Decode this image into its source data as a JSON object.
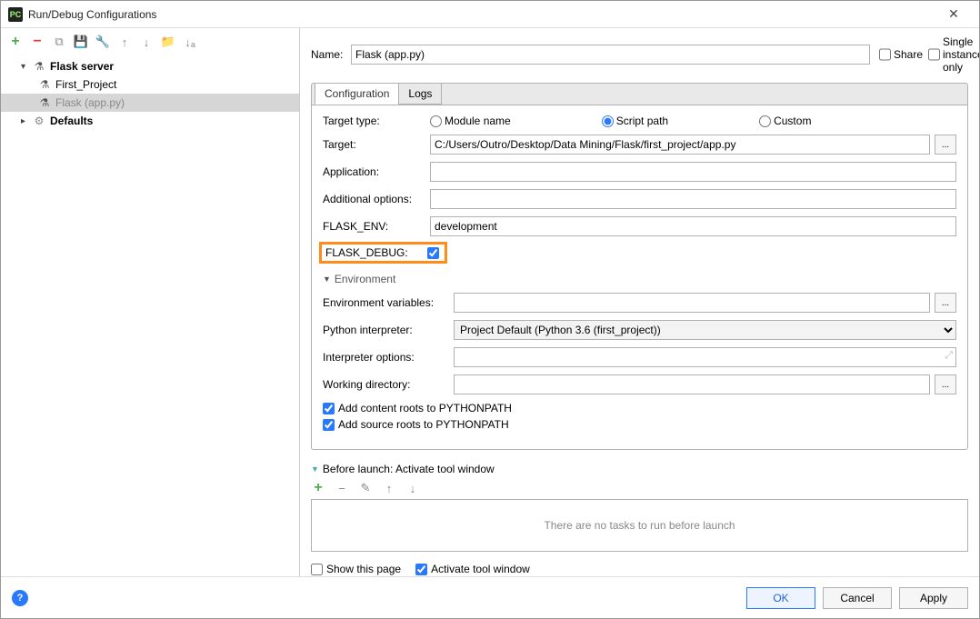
{
  "title": "Run/Debug Configurations",
  "toolbar": {
    "add": "+",
    "remove": "−"
  },
  "tree": {
    "group": "Flask server",
    "items": [
      "First_Project",
      "Flask (app.py)"
    ],
    "defaults": "Defaults"
  },
  "name": {
    "label": "Name:",
    "value": "Flask (app.py)"
  },
  "share": "Share",
  "single_instance": "Single instance only",
  "tabs": {
    "config": "Configuration",
    "logs": "Logs"
  },
  "form": {
    "target_type": "Target type:",
    "module_name": "Module name",
    "script_path": "Script path",
    "custom": "Custom",
    "target": "Target:",
    "target_value": "C:/Users/Outro/Desktop/Data Mining/Flask/first_project/app.py",
    "application": "Application:",
    "additional_options": "Additional options:",
    "flask_env": "FLASK_ENV:",
    "flask_env_value": "development",
    "flask_debug": "FLASK_DEBUG:"
  },
  "env": {
    "header": "Environment",
    "env_vars": "Environment variables:",
    "interpreter": "Python interpreter:",
    "interpreter_value": "Project Default (Python 3.6 (first_project))",
    "interp_options": "Interpreter options:",
    "working_dir": "Working directory:",
    "content_roots": "Add content roots to PYTHONPATH",
    "source_roots": "Add source roots to PYTHONPATH"
  },
  "before_launch": {
    "header": "Before launch: Activate tool window",
    "empty": "There are no tasks to run before launch"
  },
  "show_page": "Show this page",
  "activate_tool": "Activate tool window",
  "buttons": {
    "ok": "OK",
    "cancel": "Cancel",
    "apply": "Apply"
  }
}
